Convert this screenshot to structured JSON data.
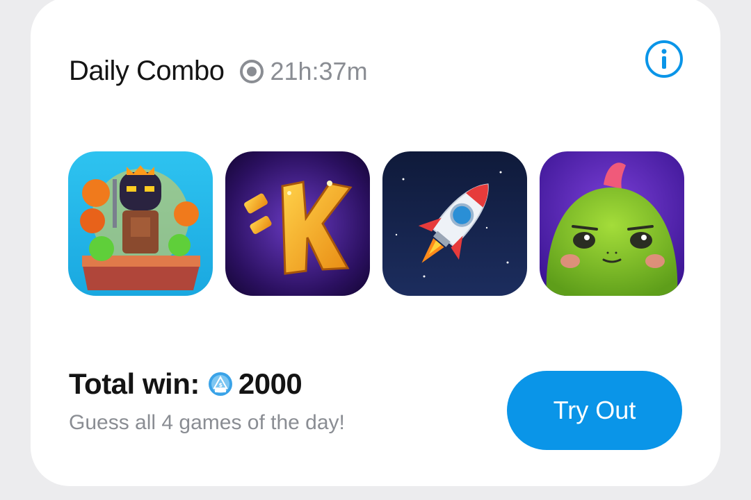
{
  "daily_combo": {
    "title": "Daily Combo",
    "timer": "21h:37m",
    "info_icon": "info-icon",
    "timer_icon": "clock-icon"
  },
  "games": [
    {
      "name_icon": "game-dungeon-hero-icon"
    },
    {
      "name_icon": "game-k-logo-icon"
    },
    {
      "name_icon": "game-rocket-icon"
    },
    {
      "name_icon": "game-green-dino-icon"
    }
  ],
  "total": {
    "label": "Total win:",
    "amount": "2000",
    "coin_icon": "coin-icon"
  },
  "subtitle": "Guess all 4 games of the day!",
  "cta": {
    "label": "Try Out"
  },
  "colors": {
    "accent": "#0a95e8",
    "muted_text": "#8a8d93",
    "card_bg": "#ffffff",
    "page_bg": "#ececee"
  }
}
